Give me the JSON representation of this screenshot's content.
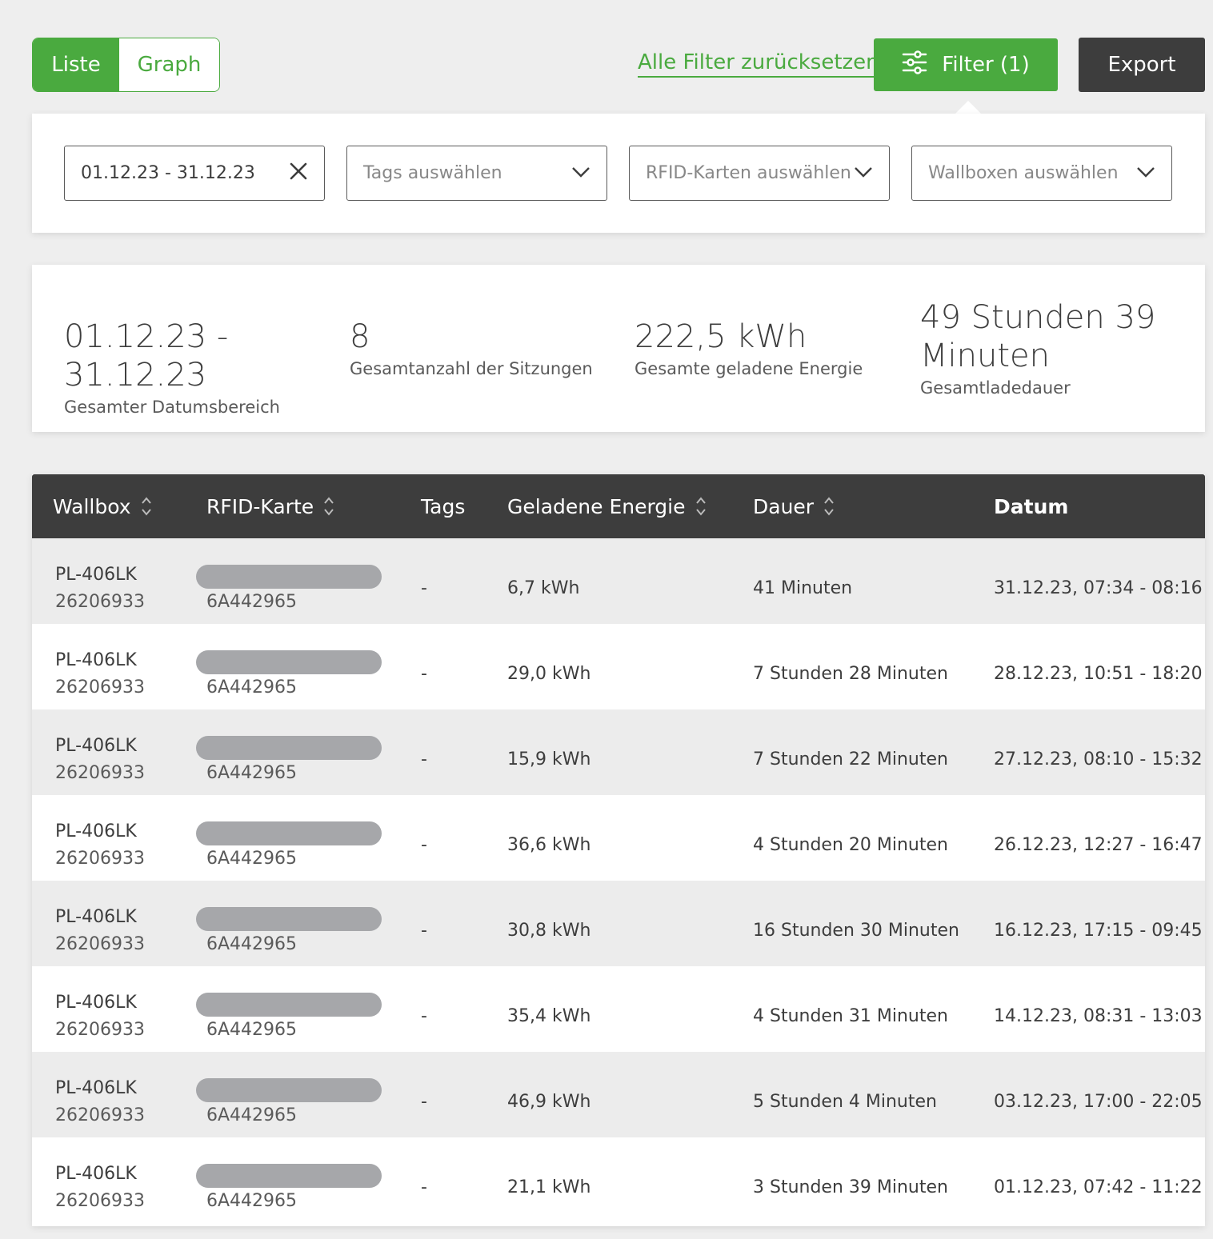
{
  "toolbar": {
    "view_list": "Liste",
    "view_graph": "Graph",
    "reset_filters": "Alle Filter zurücksetzen",
    "filter_label": "Filter (1)",
    "export_label": "Export"
  },
  "filters": {
    "date_range_value": "01.12.23 - 31.12.23",
    "tags_placeholder": "Tags auswählen",
    "rfid_placeholder": "RFID-Karten auswählen",
    "wallbox_placeholder": "Wallboxen auswählen"
  },
  "summary": {
    "date_range": "01.12.23 - 31.12.23",
    "date_range_label": "Gesamter Datumsbereich",
    "sessions": "8",
    "sessions_label": "Gesamtanzahl der Sitzungen",
    "energy": "222,5 kWh",
    "energy_label": "Gesamte geladene Energie",
    "duration": "49 Stunden 39 Minuten",
    "duration_label": "Gesamtladedauer"
  },
  "table": {
    "columns": {
      "wallbox": "Wallbox",
      "rfid": "RFID-Karte",
      "tags": "Tags",
      "energy": "Geladene Energie",
      "duration": "Dauer",
      "date": "Datum"
    },
    "rows": [
      {
        "wallbox": "PL-406LK",
        "wallbox_id": "26206933",
        "rfid_id": "6A442965",
        "tags": "-",
        "energy": "6,7 kWh",
        "duration": "41 Minuten",
        "date": "31.12.23, 07:34 - 08:16"
      },
      {
        "wallbox": "PL-406LK",
        "wallbox_id": "26206933",
        "rfid_id": "6A442965",
        "tags": "-",
        "energy": "29,0 kWh",
        "duration": "7 Stunden 28 Minuten",
        "date": "28.12.23, 10:51 - 18:20"
      },
      {
        "wallbox": "PL-406LK",
        "wallbox_id": "26206933",
        "rfid_id": "6A442965",
        "tags": "-",
        "energy": "15,9 kWh",
        "duration": "7 Stunden 22 Minuten",
        "date": "27.12.23, 08:10 - 15:32"
      },
      {
        "wallbox": "PL-406LK",
        "wallbox_id": "26206933",
        "rfid_id": "6A442965",
        "tags": "-",
        "energy": "36,6 kWh",
        "duration": "4 Stunden 20 Minuten",
        "date": "26.12.23, 12:27 - 16:47"
      },
      {
        "wallbox": "PL-406LK",
        "wallbox_id": "26206933",
        "rfid_id": "6A442965",
        "tags": "-",
        "energy": "30,8 kWh",
        "duration": "16 Stunden 30 Minuten",
        "date": "16.12.23, 17:15 - 09:45"
      },
      {
        "wallbox": "PL-406LK",
        "wallbox_id": "26206933",
        "rfid_id": "6A442965",
        "tags": "-",
        "energy": "35,4 kWh",
        "duration": "4 Stunden 31 Minuten",
        "date": "14.12.23, 08:31 - 13:03"
      },
      {
        "wallbox": "PL-406LK",
        "wallbox_id": "26206933",
        "rfid_id": "6A442965",
        "tags": "-",
        "energy": "46,9 kWh",
        "duration": "5 Stunden 4 Minuten",
        "date": "03.12.23, 17:00 - 22:05"
      },
      {
        "wallbox": "PL-406LK",
        "wallbox_id": "26206933",
        "rfid_id": "6A442965",
        "tags": "-",
        "energy": "21,1 kWh",
        "duration": "3 Stunden 39 Minuten",
        "date": "01.12.23, 07:42 - 11:22"
      }
    ]
  },
  "colors": {
    "accent": "#4aaa3f",
    "dark": "#3d3d3d",
    "row_alt": "#ececec",
    "redaction": "#a6a7aa"
  }
}
